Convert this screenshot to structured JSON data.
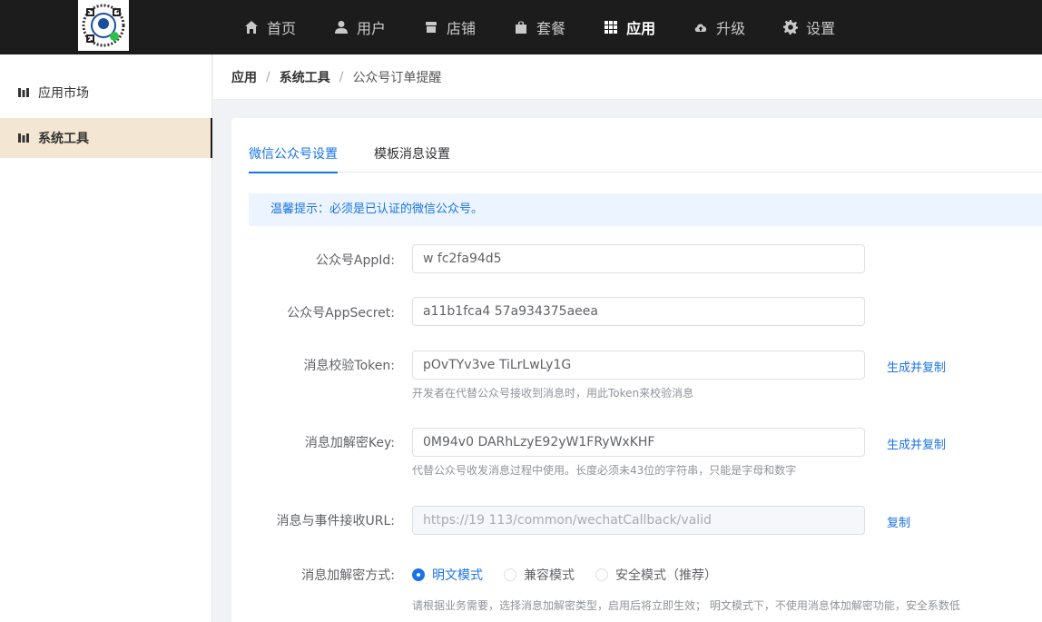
{
  "nav": {
    "items": [
      {
        "label": "首页",
        "icon": "home-icon"
      },
      {
        "label": "用户",
        "icon": "user-icon"
      },
      {
        "label": "店铺",
        "icon": "store-icon"
      },
      {
        "label": "套餐",
        "icon": "bag-icon"
      },
      {
        "label": "应用",
        "icon": "grid-icon",
        "active": true
      },
      {
        "label": "升级",
        "icon": "cloud-upload-icon"
      },
      {
        "label": "设置",
        "icon": "gear-icon"
      }
    ]
  },
  "sidebar": {
    "items": [
      {
        "label": "应用市场",
        "icon": "chart-icon"
      },
      {
        "label": "系统工具",
        "icon": "chart-icon",
        "active": true
      }
    ]
  },
  "breadcrumb": [
    "应用",
    "系统工具",
    "公众号订单提醒"
  ],
  "tabs": [
    {
      "label": "微信公众号设置",
      "active": true
    },
    {
      "label": "模板消息设置"
    }
  ],
  "alert": "温馨提示：必须是已认证的微信公众号。",
  "form": {
    "appid_label": "公众号AppId:",
    "appid_value": "w              fc2fa94d5",
    "appsecret_label": "公众号AppSecret:",
    "appsecret_value": "a11b1fca4              57a934375aeea",
    "token_label": "消息校验Token:",
    "token_value": "pOvTYv3ve              TiLrLwLy1G",
    "token_action": "生成并复制",
    "token_help": "开发者在代替公众号接收到消息时，用此Token来校验消息",
    "key_label": "消息加解密Key:",
    "key_value": "0M94v0                    DARhLzyE92yW1FRyWxKHF",
    "key_action": "生成并复制",
    "key_help": "代替公众号收发消息过程中使用。长度必须未43位的字符串，只能是字母和数字",
    "url_label": "消息与事件接收URL:",
    "url_value": "https://19        113/common/wechatCallback/valid",
    "url_action": "复制",
    "mode_label": "消息加解密方式:",
    "mode_options": [
      "明文模式",
      "兼容模式",
      "安全模式（推荐）"
    ],
    "mode_selected": "明文模式",
    "mode_help": "请根据业务需要，选择消息加解密类型，启用后将立即生效；  明文模式下，不使用消息体加解密功能，安全系数低"
  },
  "colors": {
    "topbar": "#1c1c1c",
    "accent": "#1a73e8",
    "sidebar_active": "#f3e7d4"
  }
}
